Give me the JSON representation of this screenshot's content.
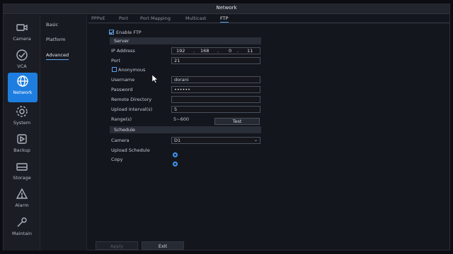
{
  "window": {
    "title": "Network"
  },
  "nav": [
    {
      "label": "Camera",
      "icon": "camera-icon"
    },
    {
      "label": "VCA",
      "icon": "vca-icon"
    },
    {
      "label": "Network",
      "icon": "globe-icon",
      "active": true
    },
    {
      "label": "System",
      "icon": "gear-icon"
    },
    {
      "label": "Backup",
      "icon": "play-icon"
    },
    {
      "label": "Storage",
      "icon": "storage-icon"
    },
    {
      "label": "Alarm",
      "icon": "warning-icon"
    },
    {
      "label": "Maintain",
      "icon": "wrench-icon"
    }
  ],
  "subnav": [
    {
      "label": "Basic"
    },
    {
      "label": "Platform"
    },
    {
      "label": "Advanced",
      "active": true
    }
  ],
  "tabs": [
    {
      "label": "PPPoE"
    },
    {
      "label": "Port"
    },
    {
      "label": "Port Mapping"
    },
    {
      "label": "Multicast"
    },
    {
      "label": "FTP",
      "active": true
    }
  ],
  "ftp": {
    "enable_label": "Enable FTP",
    "enabled": true,
    "server_header": "Server",
    "ip_label": "IP Address",
    "ip": [
      "192",
      "168",
      "0",
      "11"
    ],
    "ip_sep": ".",
    "port_label": "Port",
    "port_value": "21",
    "anonymous_label": "Anonymous",
    "anonymous": false,
    "username_label": "Username",
    "username_value": "dorani",
    "password_label": "Password",
    "password_value": "••••••",
    "remote_dir_label": "Remote Directory",
    "remote_dir_value": "",
    "upload_interval_label": "Upload Interval(s)",
    "upload_interval_value": "5",
    "range_label": "Range(s)",
    "range_value": "5~600",
    "test_label": "Test",
    "schedule_header": "Schedule",
    "camera_label": "Camera",
    "camera_value": "D1",
    "upload_schedule_label": "Upload Schedule",
    "copy_label": "Copy"
  },
  "buttons": {
    "apply": "Apply",
    "exit": "Exit"
  },
  "colors": {
    "accent": "#1e7ee0",
    "background": "#14161d"
  }
}
